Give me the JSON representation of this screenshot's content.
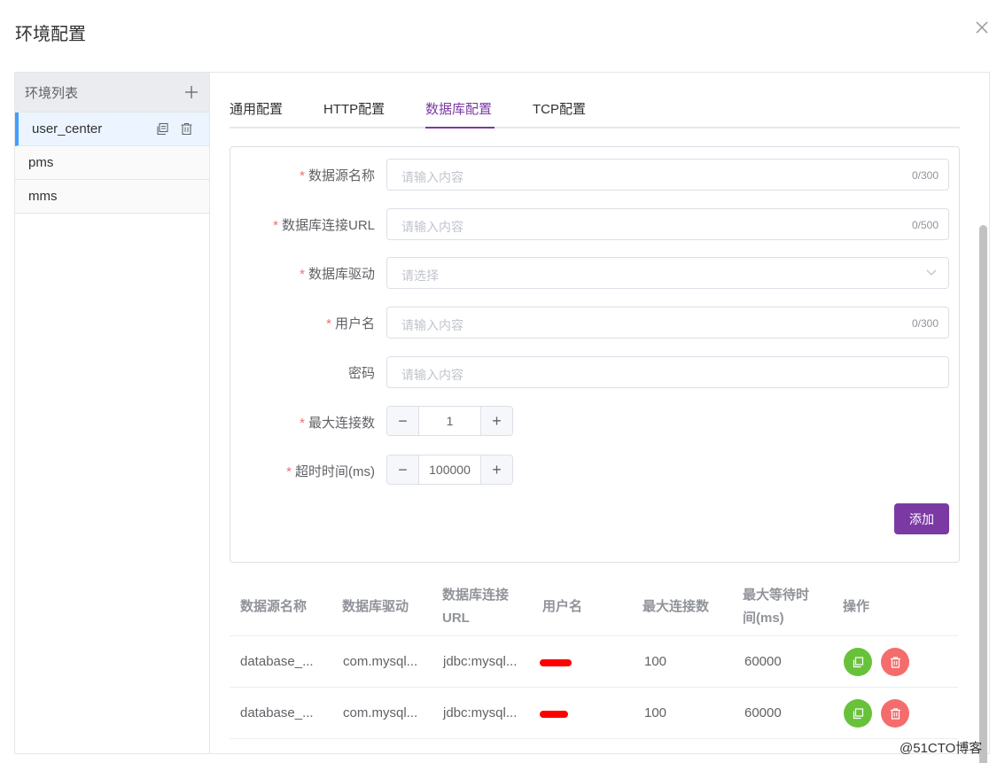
{
  "dialog": {
    "title": "环境配置",
    "close_icon": "close-icon"
  },
  "env_list": {
    "title": "环境列表",
    "items": [
      {
        "name": "user_center",
        "active": true
      },
      {
        "name": "pms"
      },
      {
        "name": "mms"
      }
    ]
  },
  "tabs": [
    {
      "label": "通用配置"
    },
    {
      "label": "HTTP配置"
    },
    {
      "label": "数据库配置",
      "active": true
    },
    {
      "label": "TCP配置"
    }
  ],
  "form": {
    "fields": {
      "datasource_name": {
        "label": "数据源名称",
        "required": "*",
        "placeholder": "请输入内容",
        "counter": "0/300"
      },
      "db_url": {
        "label": "数据库连接URL",
        "required": "*",
        "placeholder": "请输入内容",
        "counter": "0/500"
      },
      "db_driver": {
        "label": "数据库驱动",
        "required": "*",
        "placeholder": "请选择"
      },
      "username": {
        "label": "用户名",
        "required": "*",
        "placeholder": "请输入内容",
        "counter": "0/300"
      },
      "password": {
        "label": "密码",
        "placeholder": "请输入内容"
      },
      "max_connections": {
        "label": "最大连接数",
        "required": "*",
        "value": "1"
      },
      "timeout": {
        "label": "超时时间(ms)",
        "required": "*",
        "value": "100000"
      }
    },
    "add_label": "添加"
  },
  "table": {
    "headers": [
      "数据源名称",
      "数据库驱动",
      "数据库连接URL",
      "用户名",
      "最大连接数",
      "最大等待时间(ms)",
      "操作"
    ],
    "rows": [
      {
        "name": "database_...",
        "driver": "com.mysql...",
        "url": "jdbc:mysql...",
        "max_conn": "100",
        "max_wait": "60000"
      },
      {
        "name": "database_...",
        "driver": "com.mysql...",
        "url": "jdbc:mysql...",
        "max_conn": "100",
        "max_wait": "60000"
      }
    ]
  },
  "colors": {
    "accent": "#7b3aa3",
    "active_border": "#409eff",
    "required": "#f56c6c",
    "copy": "#67c23a",
    "delete": "#f56c6c"
  },
  "watermark": "@51CTO博客"
}
